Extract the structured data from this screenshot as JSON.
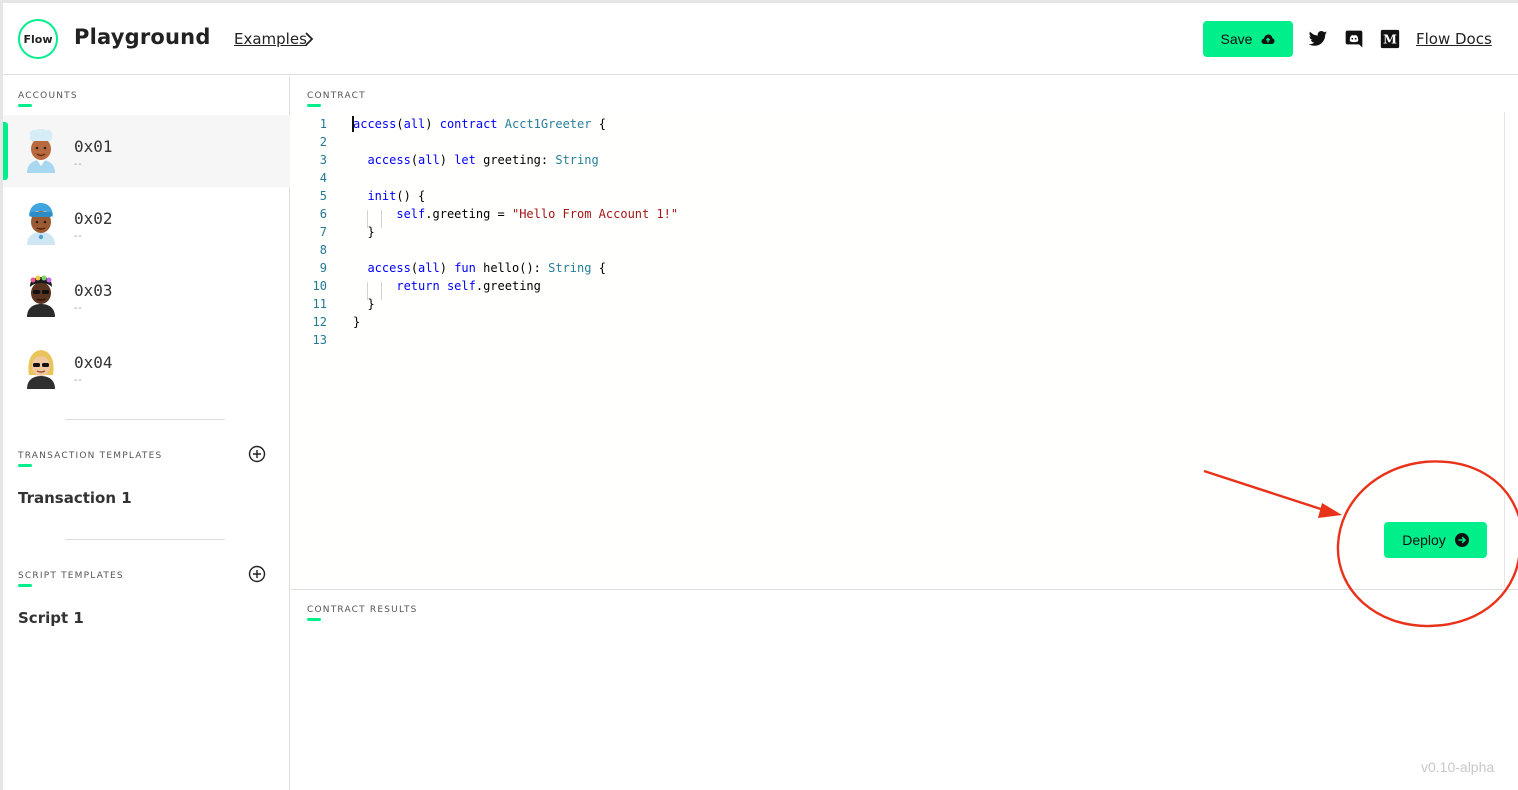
{
  "header": {
    "logo_text": "Flow",
    "app_title": "Playground",
    "examples_label": "Examples",
    "save_label": "Save",
    "docs_label": "Flow Docs",
    "accent_color": "#00ef8b"
  },
  "sidebar": {
    "accounts_label": "ACCOUNTS",
    "accounts": [
      {
        "address": "0x01",
        "sub": "--",
        "selected": true
      },
      {
        "address": "0x02",
        "sub": "--",
        "selected": false
      },
      {
        "address": "0x03",
        "sub": "--",
        "selected": false
      },
      {
        "address": "0x04",
        "sub": "--",
        "selected": false
      }
    ],
    "transaction_templates_label": "TRANSACTION TEMPLATES",
    "transaction_templates": [
      "Transaction 1"
    ],
    "script_templates_label": "SCRIPT TEMPLATES",
    "script_templates": [
      "Script 1"
    ]
  },
  "editor": {
    "label": "CONTRACT",
    "lines": [
      {
        "n": "1",
        "html": "<span class='kw'>access</span>(<span class='kw'>all</span>) <span class='kw'>contract</span> <span class='ty'>Acct1Greeter</span> {"
      },
      {
        "n": "2",
        "html": ""
      },
      {
        "n": "3",
        "html": "  <span class='kw'>access</span>(<span class='kw'>all</span>) <span class='kw'>let</span> greeting: <span class='ty'>String</span>"
      },
      {
        "n": "4",
        "html": ""
      },
      {
        "n": "5",
        "html": "  <span class='kw'>init</span>() {"
      },
      {
        "n": "6",
        "html": "      <span class='kw'>self</span>.greeting = <span class='st'>\"Hello From Account 1!\"</span>"
      },
      {
        "n": "7",
        "html": "  }"
      },
      {
        "n": "8",
        "html": ""
      },
      {
        "n": "9",
        "html": "  <span class='kw'>access</span>(<span class='kw'>all</span>) <span class='kw'>fun</span> hello(): <span class='ty'>String</span> {"
      },
      {
        "n": "10",
        "html": "      <span class='kw'>return</span> <span class='kw'>self</span>.greeting"
      },
      {
        "n": "11",
        "html": "  }"
      },
      {
        "n": "12",
        "html": "}"
      },
      {
        "n": "13",
        "html": ""
      }
    ],
    "deploy_label": "Deploy"
  },
  "results": {
    "label": "CONTRACT RESULTS"
  },
  "version": "v0.10-alpha",
  "annotation": {
    "color": "#e8321a"
  }
}
